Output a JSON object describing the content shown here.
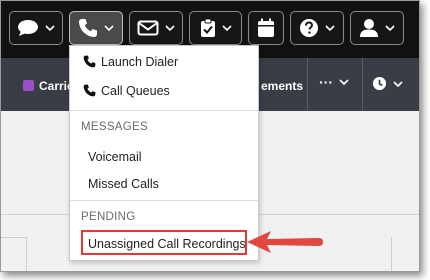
{
  "toolbar": {
    "icons": [
      "chat-icon",
      "phone-icon",
      "mail-icon",
      "clipboard-check-icon",
      "calendar-icon",
      "help-icon",
      "user-icon"
    ],
    "active": "phone-icon"
  },
  "navbar": {
    "carrier_label": "Carrie",
    "elements_label": "ements",
    "more_label": "···"
  },
  "phone_menu": {
    "items": [
      {
        "label": "Launch Dialer",
        "icon": "phone-icon"
      },
      {
        "label": "Call Queues",
        "icon": "phone-icon"
      }
    ],
    "messages_header": "MESSAGES",
    "messages": [
      "Voicemail",
      "Missed Calls"
    ],
    "pending_header": "PENDING",
    "pending": [
      "Unassigned Call Recordings"
    ]
  },
  "colors": {
    "topbar_bg": "#111111",
    "navbar_bg": "#393e46",
    "carrier_swatch": "#9b4fc9",
    "highlight": "#e53935"
  }
}
